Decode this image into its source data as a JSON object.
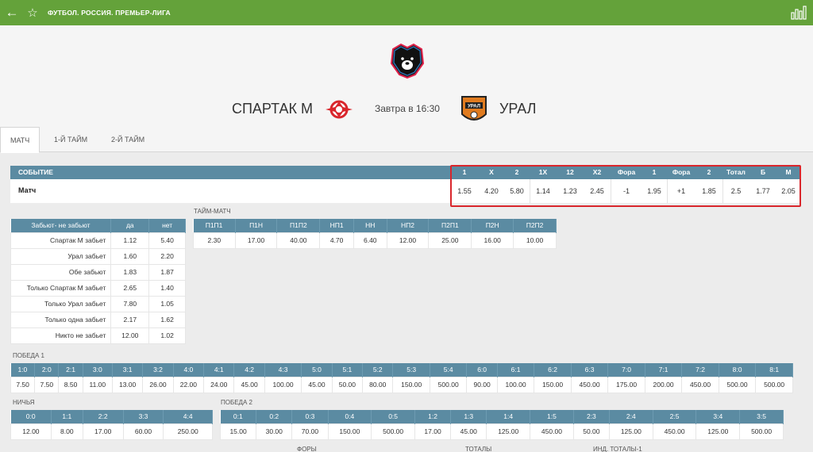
{
  "breadcrumb": "ФУТБОЛ. РОССИЯ. ПРЕМЬЕР-ЛИГА",
  "match": {
    "team1": "СПАРТАК М",
    "team2": "УРАЛ",
    "time": "Завтра в 16:30",
    "team2_logo_text": "УРАЛ"
  },
  "tabs": [
    "МАТЧ",
    "1-Й ТАЙМ",
    "2-Й ТАЙМ"
  ],
  "event": {
    "header_label": "СОБЫТИЕ",
    "row_label": "Матч",
    "columns": [
      "1",
      "X",
      "2",
      "1X",
      "12",
      "X2",
      "Фора",
      "1",
      "Фора",
      "2",
      "Тотал",
      "Б",
      "М"
    ],
    "values": [
      "1.55",
      "4.20",
      "5.80",
      "1.14",
      "1.23",
      "2.45",
      "-1",
      "1.95",
      "+1",
      "1.85",
      "2.5",
      "1.77",
      "2.05"
    ]
  },
  "score_both": {
    "headers": [
      "Забьют- не забьют",
      "да",
      "нет"
    ],
    "rows": [
      [
        "Спартак М забьет",
        "1.12",
        "5.40"
      ],
      [
        "Урал забьет",
        "1.60",
        "2.20"
      ],
      [
        "Обе забьют",
        "1.83",
        "1.87"
      ],
      [
        "Только Спартак М забьет",
        "2.65",
        "1.40"
      ],
      [
        "Только Урал забьет",
        "7.80",
        "1.05"
      ],
      [
        "Только одна забьет",
        "2.17",
        "1.62"
      ],
      [
        "Никто не забьет",
        "12.00",
        "1.02"
      ]
    ]
  },
  "half_match": {
    "label": "ТАЙМ-МАТЧ",
    "headers": [
      "П1П1",
      "П1Н",
      "П1П2",
      "НП1",
      "НН",
      "НП2",
      "П2П1",
      "П2Н",
      "П2П2"
    ],
    "values": [
      "2.30",
      "17.00",
      "40.00",
      "4.70",
      "6.40",
      "12.00",
      "25.00",
      "16.00",
      "10.00"
    ]
  },
  "win1": {
    "label": "ПОБЕДА 1",
    "headers": [
      "1:0",
      "2:0",
      "2:1",
      "3:0",
      "3:1",
      "3:2",
      "4:0",
      "4:1",
      "4:2",
      "4:3",
      "5:0",
      "5:1",
      "5:2",
      "5:3",
      "5:4",
      "6:0",
      "6:1",
      "6:2",
      "6:3",
      "7:0",
      "7:1",
      "7:2",
      "8:0",
      "8:1"
    ],
    "values": [
      "7.50",
      "7.50",
      "8.50",
      "11.00",
      "13.00",
      "26.00",
      "22.00",
      "24.00",
      "45.00",
      "100.00",
      "45.00",
      "50.00",
      "80.00",
      "150.00",
      "500.00",
      "90.00",
      "100.00",
      "150.00",
      "450.00",
      "175.00",
      "200.00",
      "450.00",
      "500.00",
      "500.00"
    ]
  },
  "draw": {
    "label": "НИЧЬЯ",
    "headers": [
      "0:0",
      "1:1",
      "2:2",
      "3:3",
      "4:4"
    ],
    "values": [
      "12.00",
      "8.00",
      "17.00",
      "60.00",
      "250.00"
    ]
  },
  "win2": {
    "label": "ПОБЕДА 2",
    "headers": [
      "0:1",
      "0:2",
      "0:3",
      "0:4",
      "0:5",
      "1:2",
      "1:3",
      "1:4",
      "1:5",
      "2:3",
      "2:4",
      "2:5",
      "3:4",
      "3:5"
    ],
    "values": [
      "15.00",
      "30.00",
      "70.00",
      "150.00",
      "500.00",
      "17.00",
      "45.00",
      "125.00",
      "450.00",
      "50.00",
      "125.00",
      "450.00",
      "125.00",
      "500.00"
    ]
  },
  "bottom_labels": [
    "ФОРЫ",
    "ТОТАЛЫ",
    "ИНД. ТОТАЛЫ-1"
  ],
  "colors": {
    "topbar": "#64a23a",
    "table_header": "#5b8ba2",
    "highlight": "#d9262c"
  },
  "icons": [
    "back-arrow-icon",
    "star-icon",
    "stats-icon",
    "league-logo-icon",
    "spartak-logo-icon",
    "ural-logo-icon"
  ]
}
